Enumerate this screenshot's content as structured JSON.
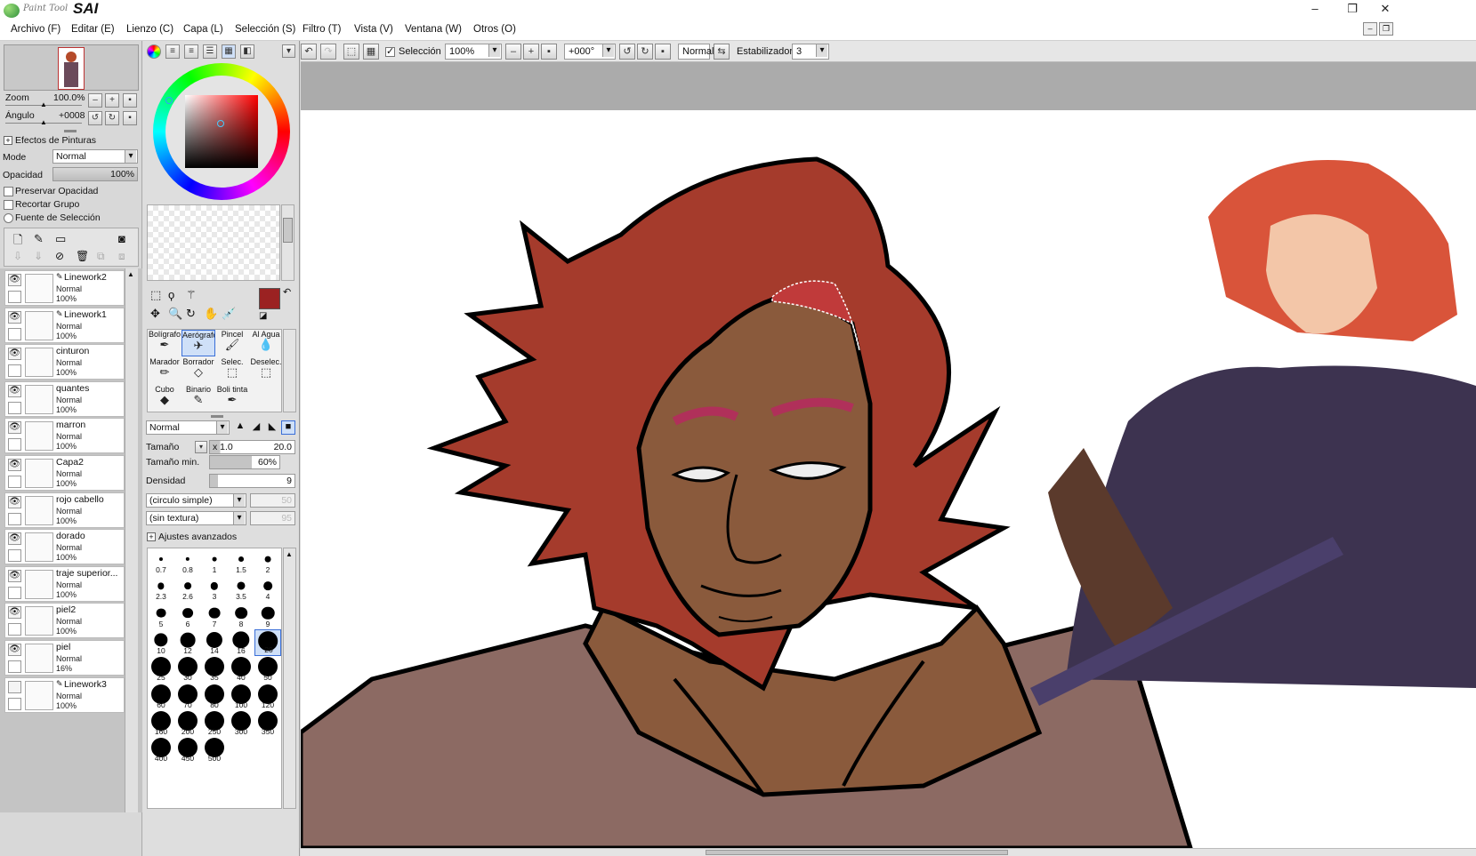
{
  "app": {
    "logo_small": "Paint Tool",
    "logo_big": "SAI"
  },
  "window": {
    "minimize": "–",
    "restore": "❐",
    "close": "✕"
  },
  "menu": [
    {
      "label": "Archivo (F)"
    },
    {
      "label": "Editar (E)"
    },
    {
      "label": "Lienzo (C)"
    },
    {
      "label": "Capa (L)"
    },
    {
      "label": "Selección (S)"
    },
    {
      "label": "Filtro (T)"
    },
    {
      "label": "Vista (V)"
    },
    {
      "label": "Ventana (W)"
    },
    {
      "label": "Otros (O)"
    }
  ],
  "navigator": {
    "zoom_label": "Zoom",
    "zoom_value": "100.0%",
    "angle_label": "Ángulo",
    "angle_value": "+0008"
  },
  "paint_effects": {
    "header": "Efectos de Pinturas",
    "mode_label": "Mode",
    "mode_value": "Normal",
    "opacity_label": "Opacidad",
    "opacity_value": "100%",
    "preserve_opacity": "Preservar Opacidad",
    "clip_group": "Recortar Grupo",
    "selection_source": "Fuente de Selección"
  },
  "layers": [
    {
      "name": "Linework2",
      "mode": "Normal",
      "opacity": "100%",
      "visible": true,
      "pen": true
    },
    {
      "name": "Linework1",
      "mode": "Normal",
      "opacity": "100%",
      "visible": true,
      "pen": true
    },
    {
      "name": "cinturon",
      "mode": "Normal",
      "opacity": "100%",
      "visible": true,
      "pen": false
    },
    {
      "name": "quantes",
      "mode": "Normal",
      "opacity": "100%",
      "visible": true,
      "pen": false
    },
    {
      "name": "marron",
      "mode": "Normal",
      "opacity": "100%",
      "visible": true,
      "pen": false
    },
    {
      "name": "Capa2",
      "mode": "Normal",
      "opacity": "100%",
      "visible": true,
      "pen": false
    },
    {
      "name": "rojo cabello",
      "mode": "Normal",
      "opacity": "100%",
      "visible": true,
      "pen": false
    },
    {
      "name": "dorado",
      "mode": "Normal",
      "opacity": "100%",
      "visible": true,
      "pen": false
    },
    {
      "name": "traje superior...",
      "mode": "Normal",
      "opacity": "100%",
      "visible": true,
      "pen": false
    },
    {
      "name": "piel2",
      "mode": "Normal",
      "opacity": "100%",
      "visible": true,
      "pen": false
    },
    {
      "name": "piel",
      "mode": "Normal",
      "opacity": "16%",
      "visible": true,
      "pen": false
    },
    {
      "name": "Linework3",
      "mode": "Normal",
      "opacity": "100%",
      "visible": false,
      "pen": true
    }
  ],
  "colors": {
    "primary": "#9b2222",
    "secondary": "#ffffff",
    "hair": "#a53b2c",
    "skin": "#8a5a3c",
    "shirt": "#8c6a63"
  },
  "tools": [
    {
      "label": "Bolígrafo",
      "icon": "✒"
    },
    {
      "label": "Aerógrafo",
      "icon": "✈",
      "active": true
    },
    {
      "label": "Pincel",
      "icon": "🖌"
    },
    {
      "label": "Al Agua",
      "icon": "💧"
    },
    {
      "label": "Marador",
      "icon": "✏"
    },
    {
      "label": "Borrador",
      "icon": "◇"
    },
    {
      "label": "Selec.",
      "icon": "⬚"
    },
    {
      "label": "Deselec.",
      "icon": "⬚"
    },
    {
      "label": "Cubo",
      "icon": "◆"
    },
    {
      "label": "Binario",
      "icon": "✎"
    },
    {
      "label": "Boli tinta",
      "icon": "✒"
    }
  ],
  "brush": {
    "blend_value": "Normal",
    "size_label": "Tamaño",
    "size_mult": "x 1.0",
    "size_value": "20.0",
    "min_size_label": "Tamaño min.",
    "min_size_value": "60%",
    "min_size_fraction": 0.6,
    "density_label": "Densidad",
    "density_value": "9",
    "density_fraction": 0.09,
    "shape_value": "(circulo simple)",
    "shape_num": "50",
    "texture_value": "(sin textura)",
    "texture_num": "95",
    "advanced": "Ajustes avanzados"
  },
  "brush_sizes": [
    "0.7",
    "0.8",
    "1",
    "1.5",
    "2",
    "2.3",
    "2.6",
    "3",
    "3.5",
    "4",
    "5",
    "6",
    "7",
    "8",
    "9",
    "10",
    "12",
    "14",
    "16",
    "20",
    "25",
    "30",
    "35",
    "40",
    "50",
    "60",
    "70",
    "80",
    "100",
    "120",
    "160",
    "200",
    "250",
    "300",
    "350",
    "400",
    "450",
    "500"
  ],
  "selected_brush_size": "20",
  "toolbar": {
    "selection_label": "Selección",
    "zoom_value": "100%",
    "rotation_value": "+000°",
    "blend_value": "Normal",
    "stabilizer_label": "Estabilizador",
    "stabilizer_value": "3"
  }
}
